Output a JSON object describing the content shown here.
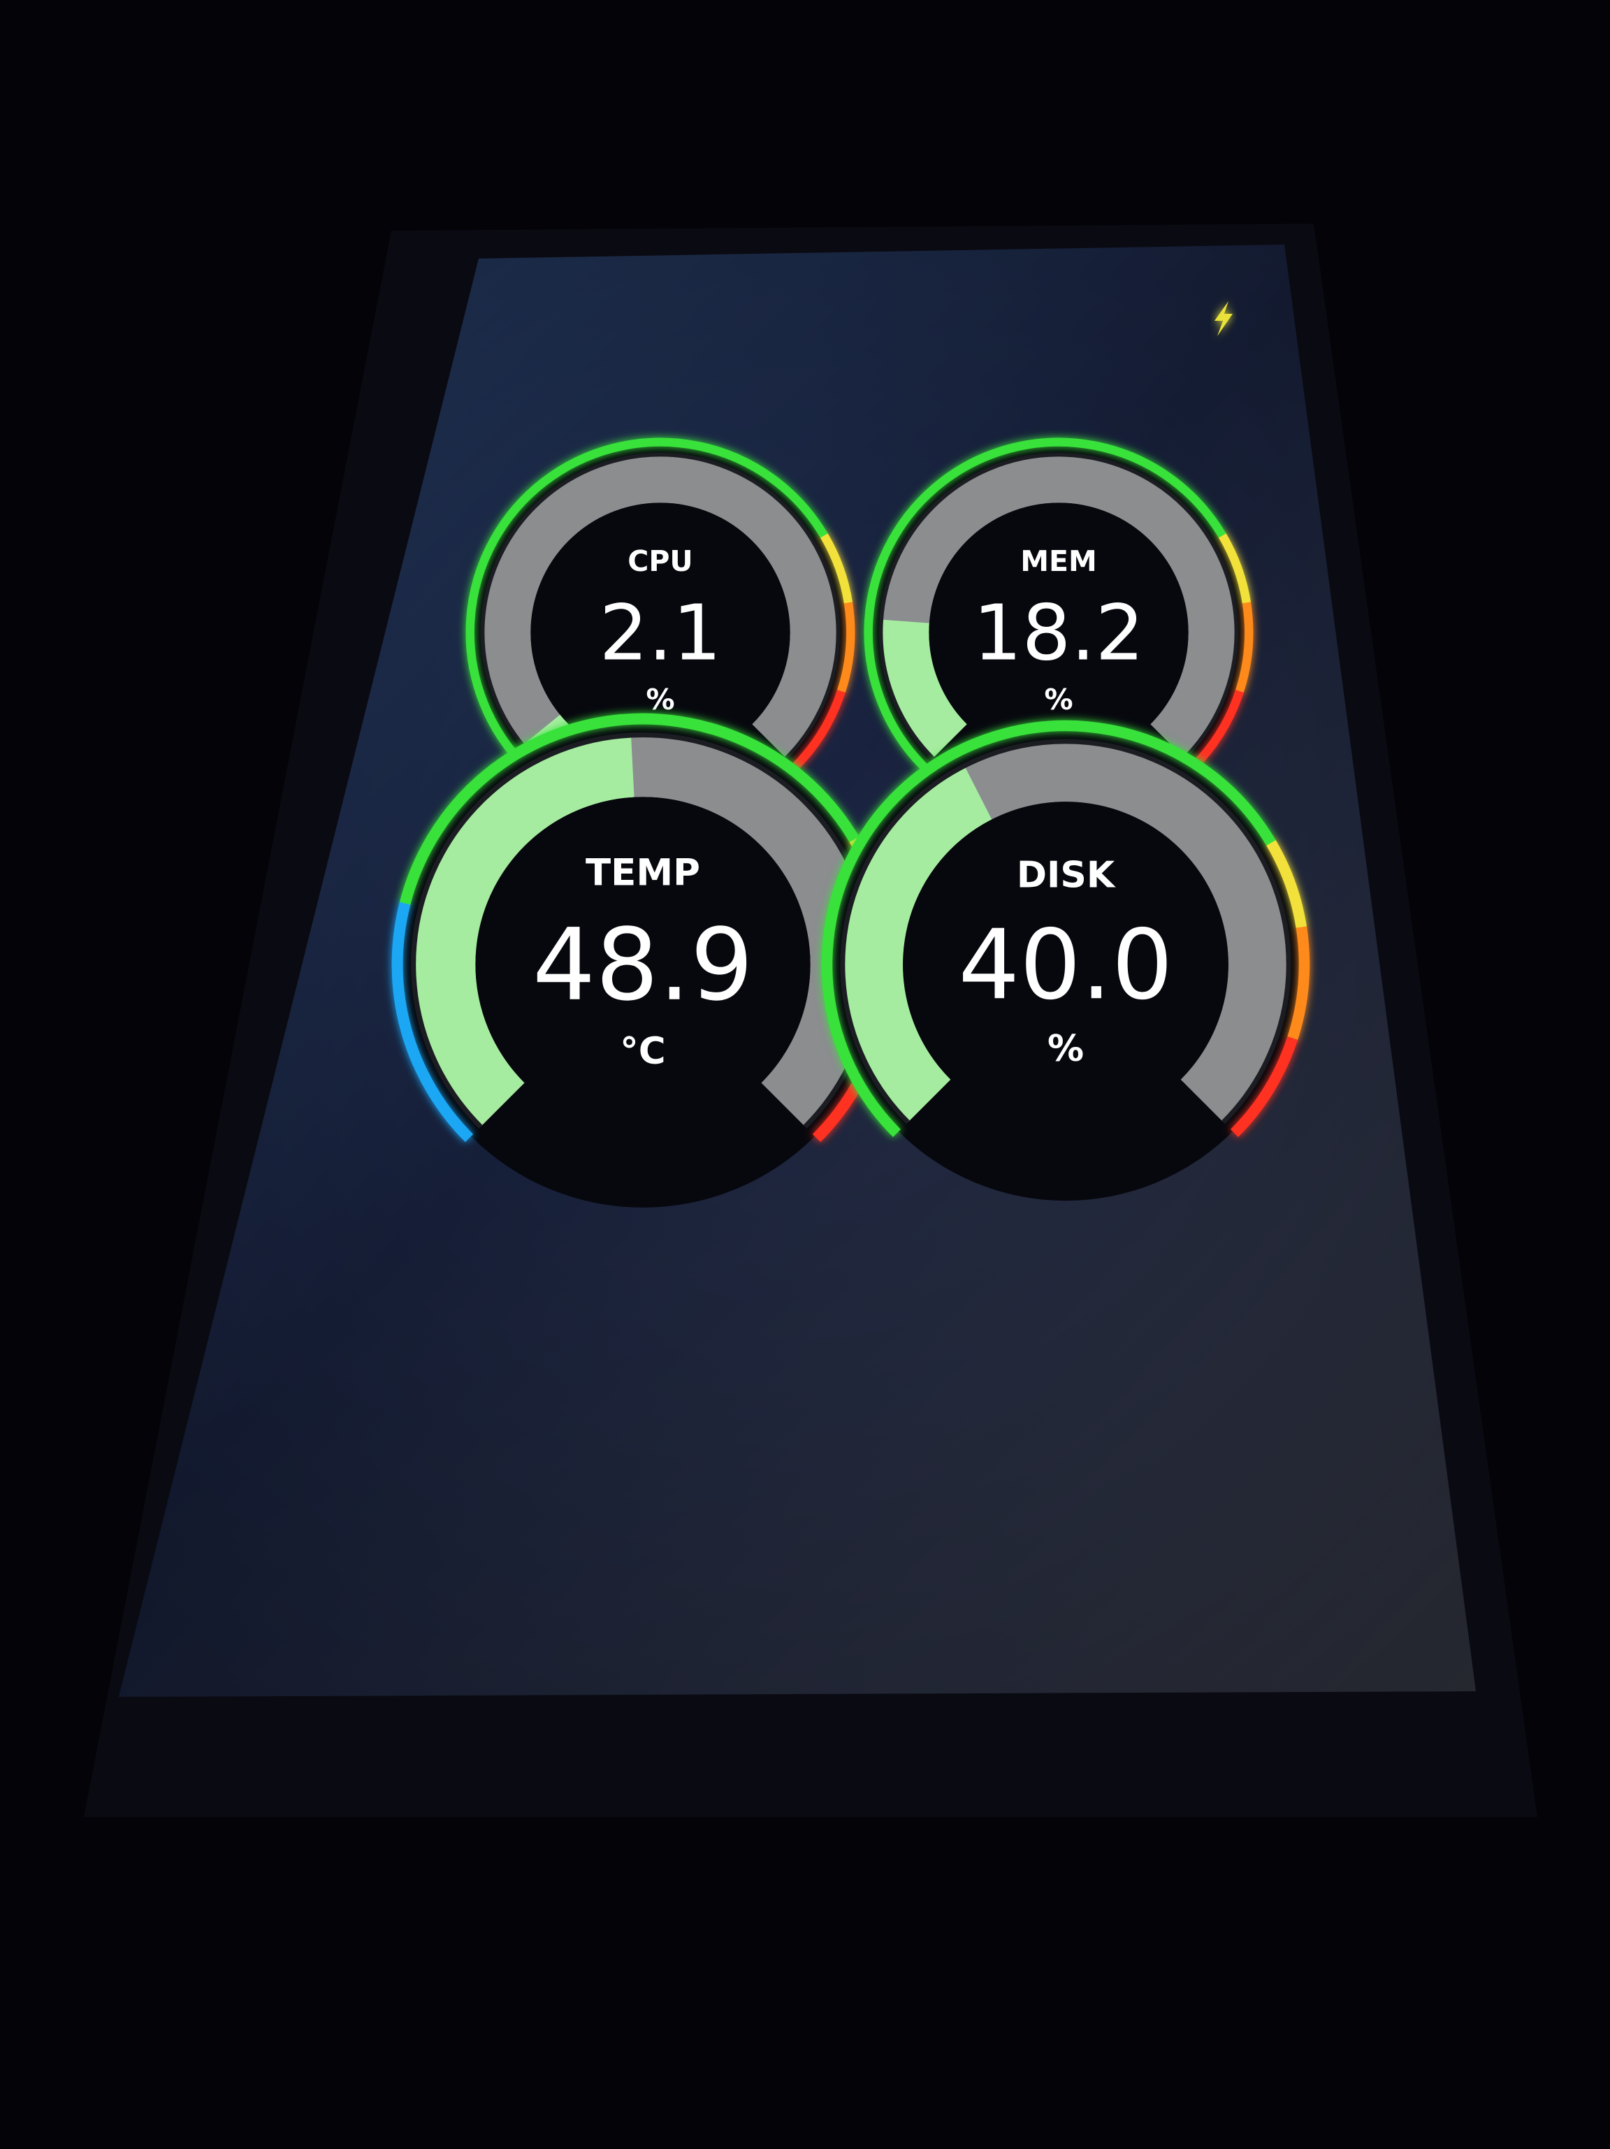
{
  "status": {
    "indicator_icon": "bolt-icon",
    "indicator_color": "#e8e23a"
  },
  "colors": {
    "screen_top": "#22395f",
    "screen_bottom": "#151c33",
    "gauge_bg": "#07080e",
    "track": "#8b8d8f",
    "fill": "#a6eca0",
    "ring_green": "#39e23a",
    "ring_yellow": "#f3e13a",
    "ring_orange": "#ff8a1c",
    "ring_red": "#ff3020",
    "ring_blue": "#1aa7f5"
  },
  "gauges": [
    {
      "label": "CPU",
      "value": "2.1",
      "unit": "%",
      "level": 0.021
    },
    {
      "label": "MEM",
      "value": "18.2",
      "unit": "%",
      "level": 0.182
    },
    {
      "label": "TEMP",
      "value": "48.9",
      "unit": "°C",
      "level": 0.489
    },
    {
      "label": "DISK",
      "value": "40.0",
      "unit": "%",
      "level": 0.4
    }
  ]
}
